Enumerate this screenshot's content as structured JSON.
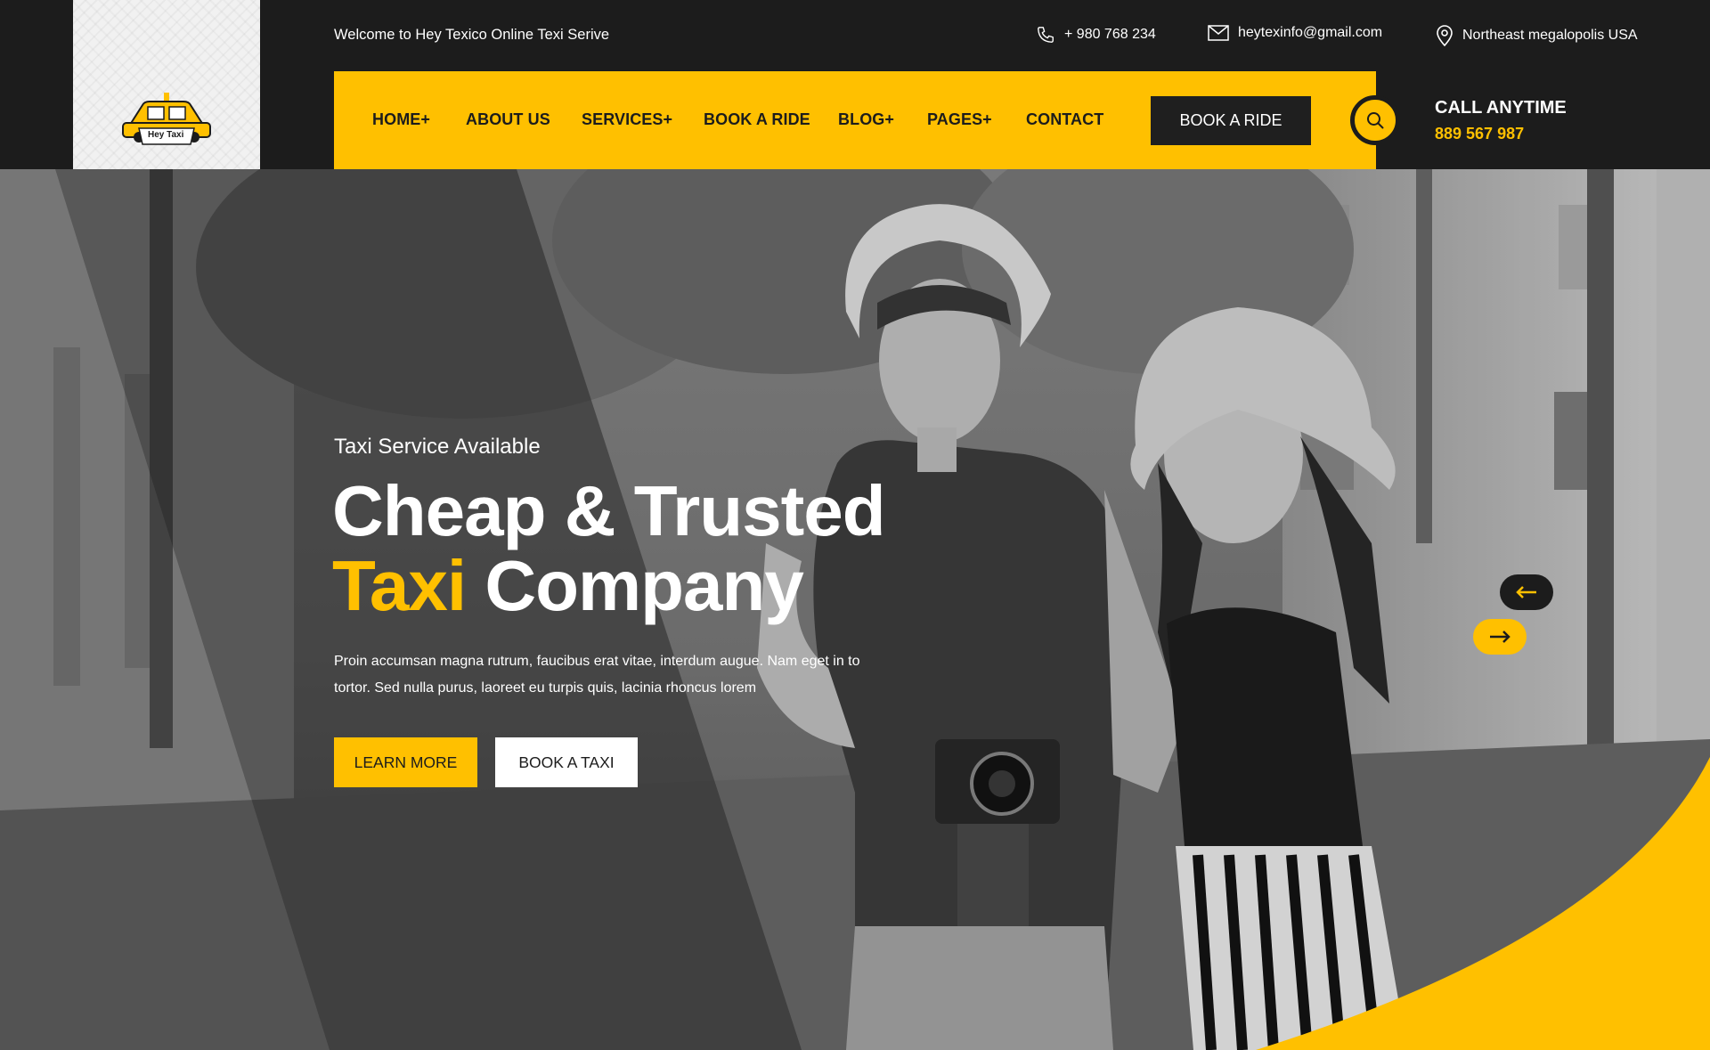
{
  "brand": {
    "logo_text": "Hey Taxi"
  },
  "topbar": {
    "welcome": "Welcome to Hey Texico Online Texi Serive",
    "phone": "+ 980 768 234",
    "email": "heytexinfo@gmail.com",
    "location": "Northeast megalopolis USA"
  },
  "nav": {
    "items": [
      {
        "label": "HOME+"
      },
      {
        "label": "ABOUT US"
      },
      {
        "label": "SERVICES+"
      },
      {
        "label": "BOOK A RIDE"
      },
      {
        "label": "BLOG+"
      },
      {
        "label": "PAGES+"
      },
      {
        "label": "CONTACT"
      }
    ],
    "cta": "BOOK A RIDE"
  },
  "call": {
    "title": "CALL ANYTIME",
    "number": "889 567 987"
  },
  "hero": {
    "subtitle": "Taxi Service Available",
    "headline_line1": "Cheap & Trusted",
    "headline_accent": "Taxi",
    "headline_rest": "Company",
    "description": "Proin accumsan magna rutrum, faucibus erat vitae, interdum augue. Nam eget  in to tortor. Sed nulla purus, laoreet eu turpis quis, lacinia rhoncus lorem",
    "btn_primary": "LEARN MORE",
    "btn_secondary": "BOOK A TAXI"
  },
  "colors": {
    "accent": "#ffc000",
    "dark": "#1c1c1c",
    "light": "#ffffff"
  },
  "icons": {
    "phone": "phone-icon",
    "email": "mail-icon",
    "location": "location-pin-icon",
    "search": "search-icon",
    "prev": "arrow-left-icon",
    "next": "arrow-right-icon"
  }
}
